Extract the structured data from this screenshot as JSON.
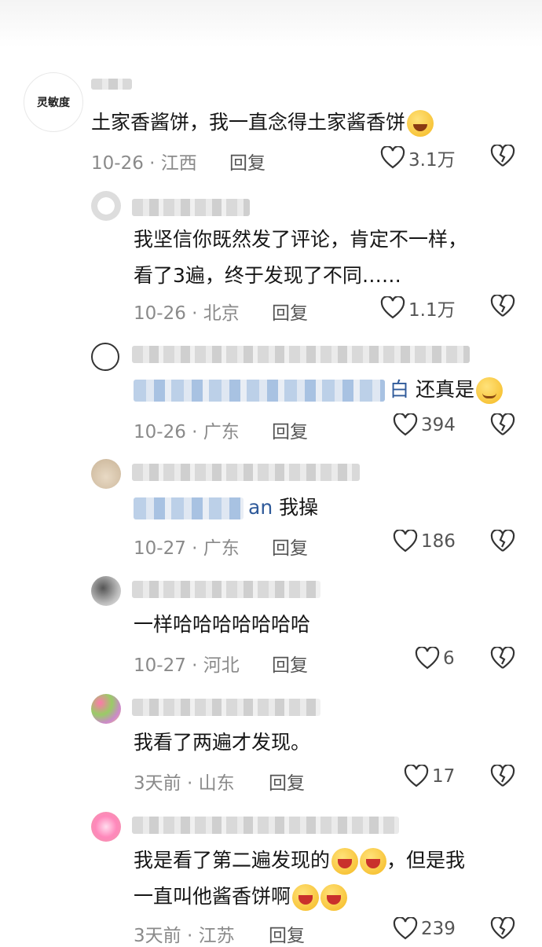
{
  "comments": [
    {
      "avatar_text": "灵敏度",
      "text": "土家香酱饼，我一直念得土家酱香饼",
      "emoji": "smile",
      "date": "10-26",
      "location": "江西",
      "reply_label": "回复",
      "likes": "3.1万"
    },
    {
      "text_line1": "我坚信你既然发了评论，肯定不一样，",
      "text_line2": "看了3遍，终于发现了不同……",
      "date": "10-26",
      "location": "北京",
      "reply_label": "回复",
      "likes": "1.1万"
    },
    {
      "mention_visible": "白",
      "text": "还真是",
      "emoji": "smile",
      "date": "10-26",
      "location": "广东",
      "reply_label": "回复",
      "likes": "394"
    },
    {
      "mention_visible": "an",
      "text": "我操",
      "date": "10-27",
      "location": "广东",
      "reply_label": "回复",
      "likes": "186"
    },
    {
      "text": "一样哈哈哈哈哈哈哈",
      "date": "10-27",
      "location": "河北",
      "reply_label": "回复",
      "likes": "6"
    },
    {
      "text": "我看了两遍才发现。",
      "date": "3天前",
      "location": "山东",
      "reply_label": "回复",
      "likes": "17"
    },
    {
      "text_line1a": "我是看了第二遍发现的",
      "text_line1b": "，但是我",
      "text_line2": "一直叫他酱香饼啊",
      "date": "3天前",
      "location": "江苏",
      "reply_label": "回复",
      "likes": "239"
    }
  ],
  "colors": {
    "mention": "#2f5a9a",
    "meta": "#8a8a8a",
    "text": "#161616"
  },
  "icons": {
    "like": "heart-outline-icon",
    "dislike": "broken-heart-icon"
  }
}
